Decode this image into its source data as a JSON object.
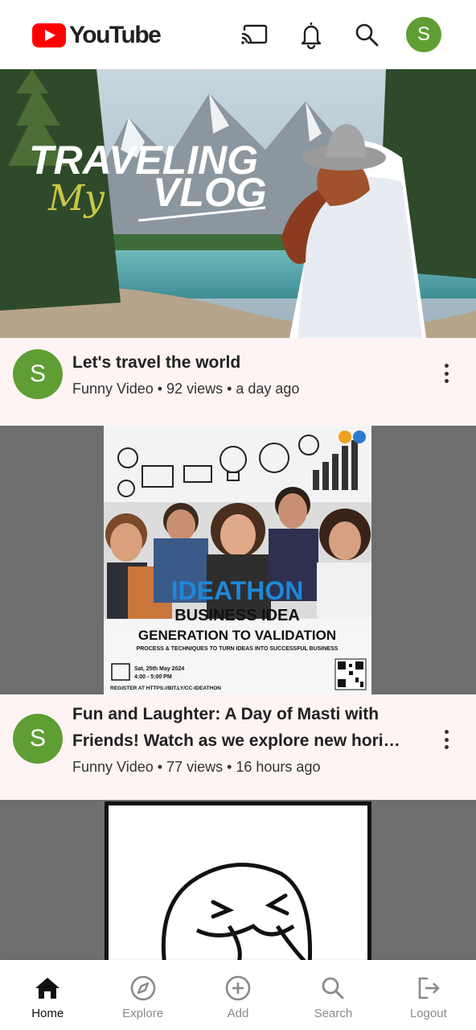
{
  "app": {
    "logo_text": "YouTube",
    "avatar_letter": "S",
    "brand_red": "#ff0000",
    "avatar_color": "#5f9e35"
  },
  "header_icons": [
    "cast-icon",
    "bell-icon",
    "search-icon"
  ],
  "feed": [
    {
      "thumb_title": "TRAVELING",
      "thumb_script": "My",
      "thumb_subtitle": "VLOG",
      "channel_letter": "S",
      "title": "Let's travel the world",
      "subtitle": "Funny Video • 92 views • a day ago"
    },
    {
      "poster_headline": "IDEATHON",
      "poster_line1": "BUSINESS IDEA",
      "poster_line2": "GENERATION TO VALIDATION",
      "poster_line3": "PROCESS & TECHNIQUES TO TURN IDEAS INTO SUCCESSFUL BUSINESS",
      "poster_date": "Sat, 25th May 2024",
      "poster_time": "4:00 - 5:00 PM",
      "poster_register": "REGISTER AT HTTPS://BIT.LY/CC-IDEATHON",
      "channel_letter": "S",
      "title": "Fun and Laughter: A Day of Masti with Friends! Watch as we explore new hori…",
      "subtitle": "Funny Video • 77 views • 16 hours ago"
    }
  ],
  "bottom_nav": [
    {
      "label": "Home",
      "icon": "home-icon",
      "active": true
    },
    {
      "label": "Explore",
      "icon": "compass-icon",
      "active": false
    },
    {
      "label": "Add",
      "icon": "add-circle-icon",
      "active": false
    },
    {
      "label": "Search",
      "icon": "search-icon",
      "active": false
    },
    {
      "label": "Logout",
      "icon": "logout-icon",
      "active": false
    }
  ]
}
